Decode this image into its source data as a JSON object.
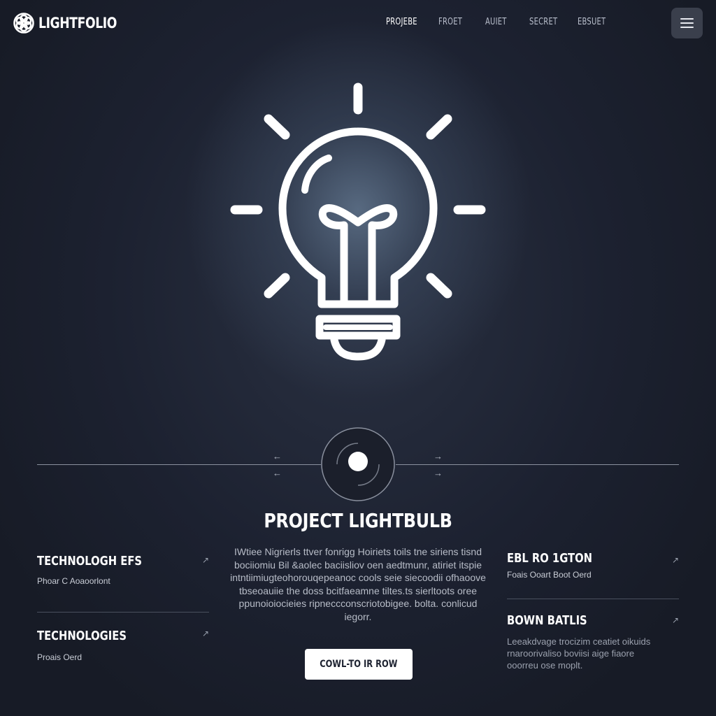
{
  "brand": {
    "name": "LIGHTFOLIO"
  },
  "nav": {
    "links": [
      "PROJEBE",
      "FROET",
      "AUIET",
      "SECRET",
      "EBSUET"
    ],
    "active_index": 0
  },
  "menu": {
    "icon": "hamburger-icon"
  },
  "hero": {
    "icon": "lightbulb-icon"
  },
  "slider": {
    "prev_arrow": "←",
    "next_arrow": "→",
    "knob_icon": "circle-dot-icon"
  },
  "project": {
    "title": "PROJECT LIGHTBULB",
    "description": "IWtiee Nigrierls ttver fonrigg Hoiriets toils tne siriens tisnd bociiomiu Bil &aolec baciisliov oen aedtmunr, atiriet itspie intntiimiugteohorouqepeanoc cools seie siecoodii ofhaoove tbseoauiie the doss bcitfaeamne tiltes.ts sierltoots oree ppunoioiocieies ripneccconscriotobigee. bolta. conlicud iegorr.",
    "cta_label": "COWL-TO IR ROW"
  },
  "cards": {
    "left": [
      {
        "title": "TECHNOLOGH EFS",
        "subtitle": "Phoar C Aoaoorlont",
        "arrow": "↗"
      },
      {
        "title": "TECHNOLOGIES",
        "subtitle": "Proais Oerd",
        "arrow": "↗"
      }
    ],
    "right": [
      {
        "title": "EBL RO 1GTON",
        "subtitle": "Foais Ooart Boot Oerd",
        "arrow": "↗"
      },
      {
        "title": "BOWN BATLIS",
        "body": "Leeakdvage trocizim ceatiet oikuids rnaroorivaliso boviisi aige fiaore ooorreu ose moplt.",
        "arrow": "↗"
      }
    ]
  },
  "colors": {
    "background": "#1c2130",
    "glow": "#5a6c84",
    "accent": "#ffffff",
    "muted_text": "#9ba1ae",
    "menu_button": "#3a3f4c"
  }
}
